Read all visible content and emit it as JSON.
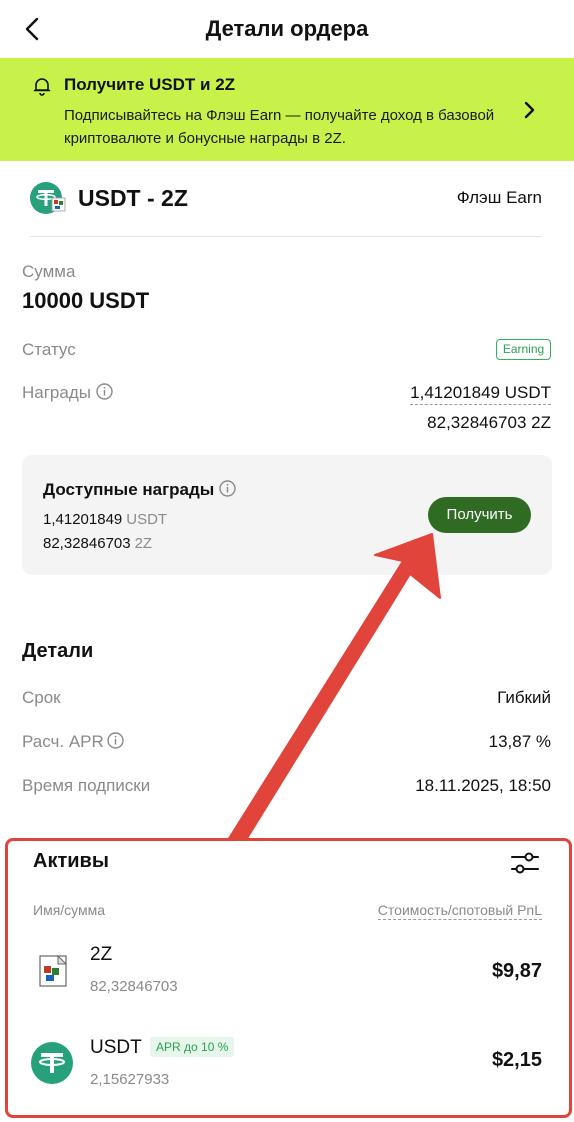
{
  "header": {
    "title": "Детали ордера",
    "back_icon": "chevron-left-icon"
  },
  "banner": {
    "title": "Получите USDT и 2Z",
    "text": "Подписывайтесь на Флэш Earn — получайте доход в базовой криптовалюте и бонусные награды в 2Z.",
    "background": "#c8f24a"
  },
  "product": {
    "name": "USDT - 2Z",
    "type": "Флэш Earn"
  },
  "summary": {
    "amount_label": "Сумма",
    "amount_value": "10000 USDT",
    "status_label": "Статус",
    "status_value": "Earning",
    "rewards_label": "Награды",
    "rewards_usdt": "1,41201849 USDT",
    "rewards_2z": "82,32846703 2Z"
  },
  "available": {
    "title": "Доступные награды",
    "usdt_amount": "1,41201849",
    "usdt_unit": "USDT",
    "z_amount": "82,32846703",
    "z_unit": "2Z",
    "claim_label": "Получить",
    "claim_color": "#2f6b22"
  },
  "details": {
    "title": "Детали",
    "term_label": "Срок",
    "term_value": "Гибкий",
    "apr_label": "Расч. APR",
    "apr_value": "13,87 %",
    "time_label": "Время подписки",
    "time_value": "18.11.2025, 18:50"
  },
  "assets": {
    "title": "Активы",
    "col_left": "Имя/сумма",
    "col_right": "Стоимость/спотовый PnL",
    "items": [
      {
        "name": "2Z",
        "amount": "82,32846703",
        "value": "$9,87",
        "icon": "2z-token-icon"
      },
      {
        "name": "USDT",
        "tag": "APR до 10 %",
        "amount": "2,15627933",
        "value": "$2,15",
        "icon": "usdt-token-icon"
      }
    ]
  },
  "annotation": {
    "color": "#e0443a"
  }
}
